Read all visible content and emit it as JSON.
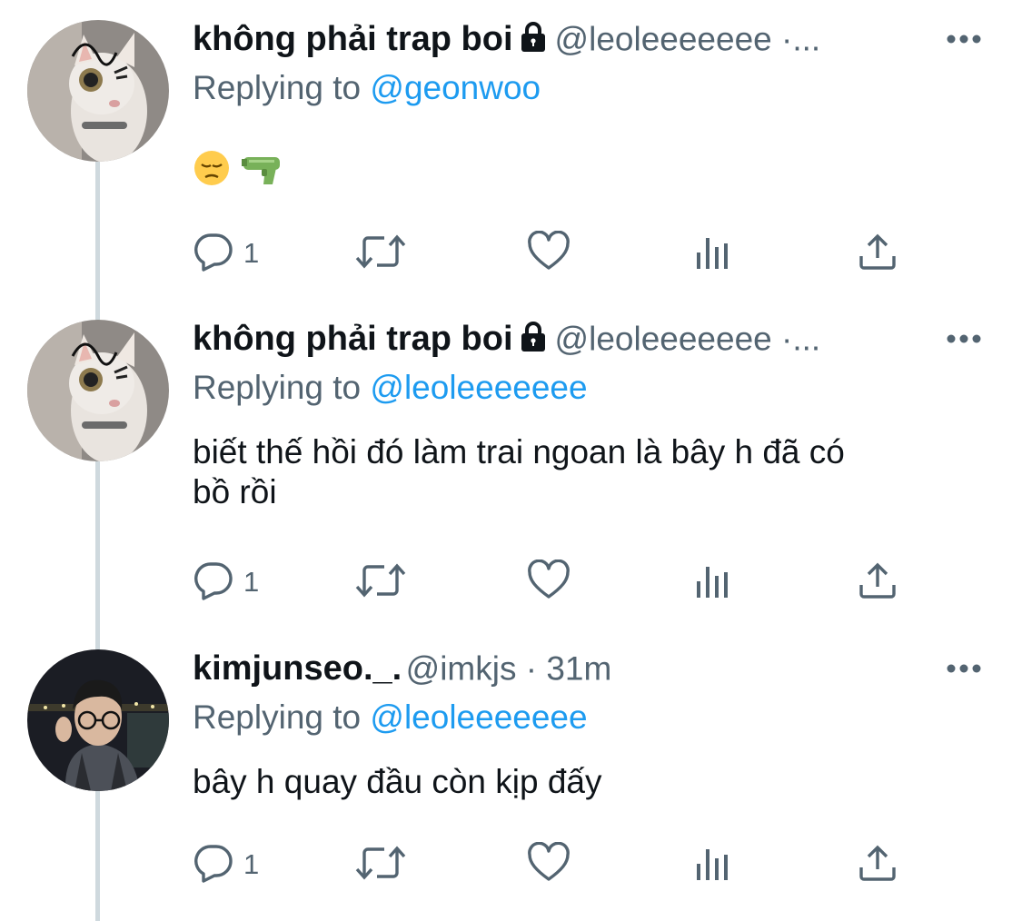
{
  "tweets": [
    {
      "name": "không phải trap boi",
      "handle": "@leoleeeeeee ·...",
      "reply_prefix": "Replying to",
      "reply_to": "@geonwoo",
      "text": "",
      "emojis": [
        "pensive-face",
        "water-pistol"
      ],
      "reply_count": "1",
      "locked": true
    },
    {
      "name": "không phải trap boi",
      "handle": "@leoleeeeeee ·...",
      "reply_prefix": "Replying to",
      "reply_to": "@leoleeeeeee",
      "text_line1": "biết thế hồi đó làm trai ngoan là bây h đã có",
      "text_line2": "bồ rồi",
      "reply_count": "1",
      "locked": true
    },
    {
      "name": "kimjunseo._.",
      "handle": "@imkjs · 31m",
      "reply_prefix": "Replying to",
      "reply_to": "@leoleeeeeee",
      "text_line1": "bây h quay đầu còn kịp đấy",
      "reply_count": "1",
      "locked": false
    }
  ],
  "colors": {
    "accent": "#1d9bf0",
    "secondary_text": "#536471",
    "thread_line": "#cfd9de"
  },
  "icons": [
    "reply-icon",
    "retweet-icon",
    "like-icon",
    "views-icon",
    "share-icon",
    "more-icon",
    "lock-icon"
  ]
}
